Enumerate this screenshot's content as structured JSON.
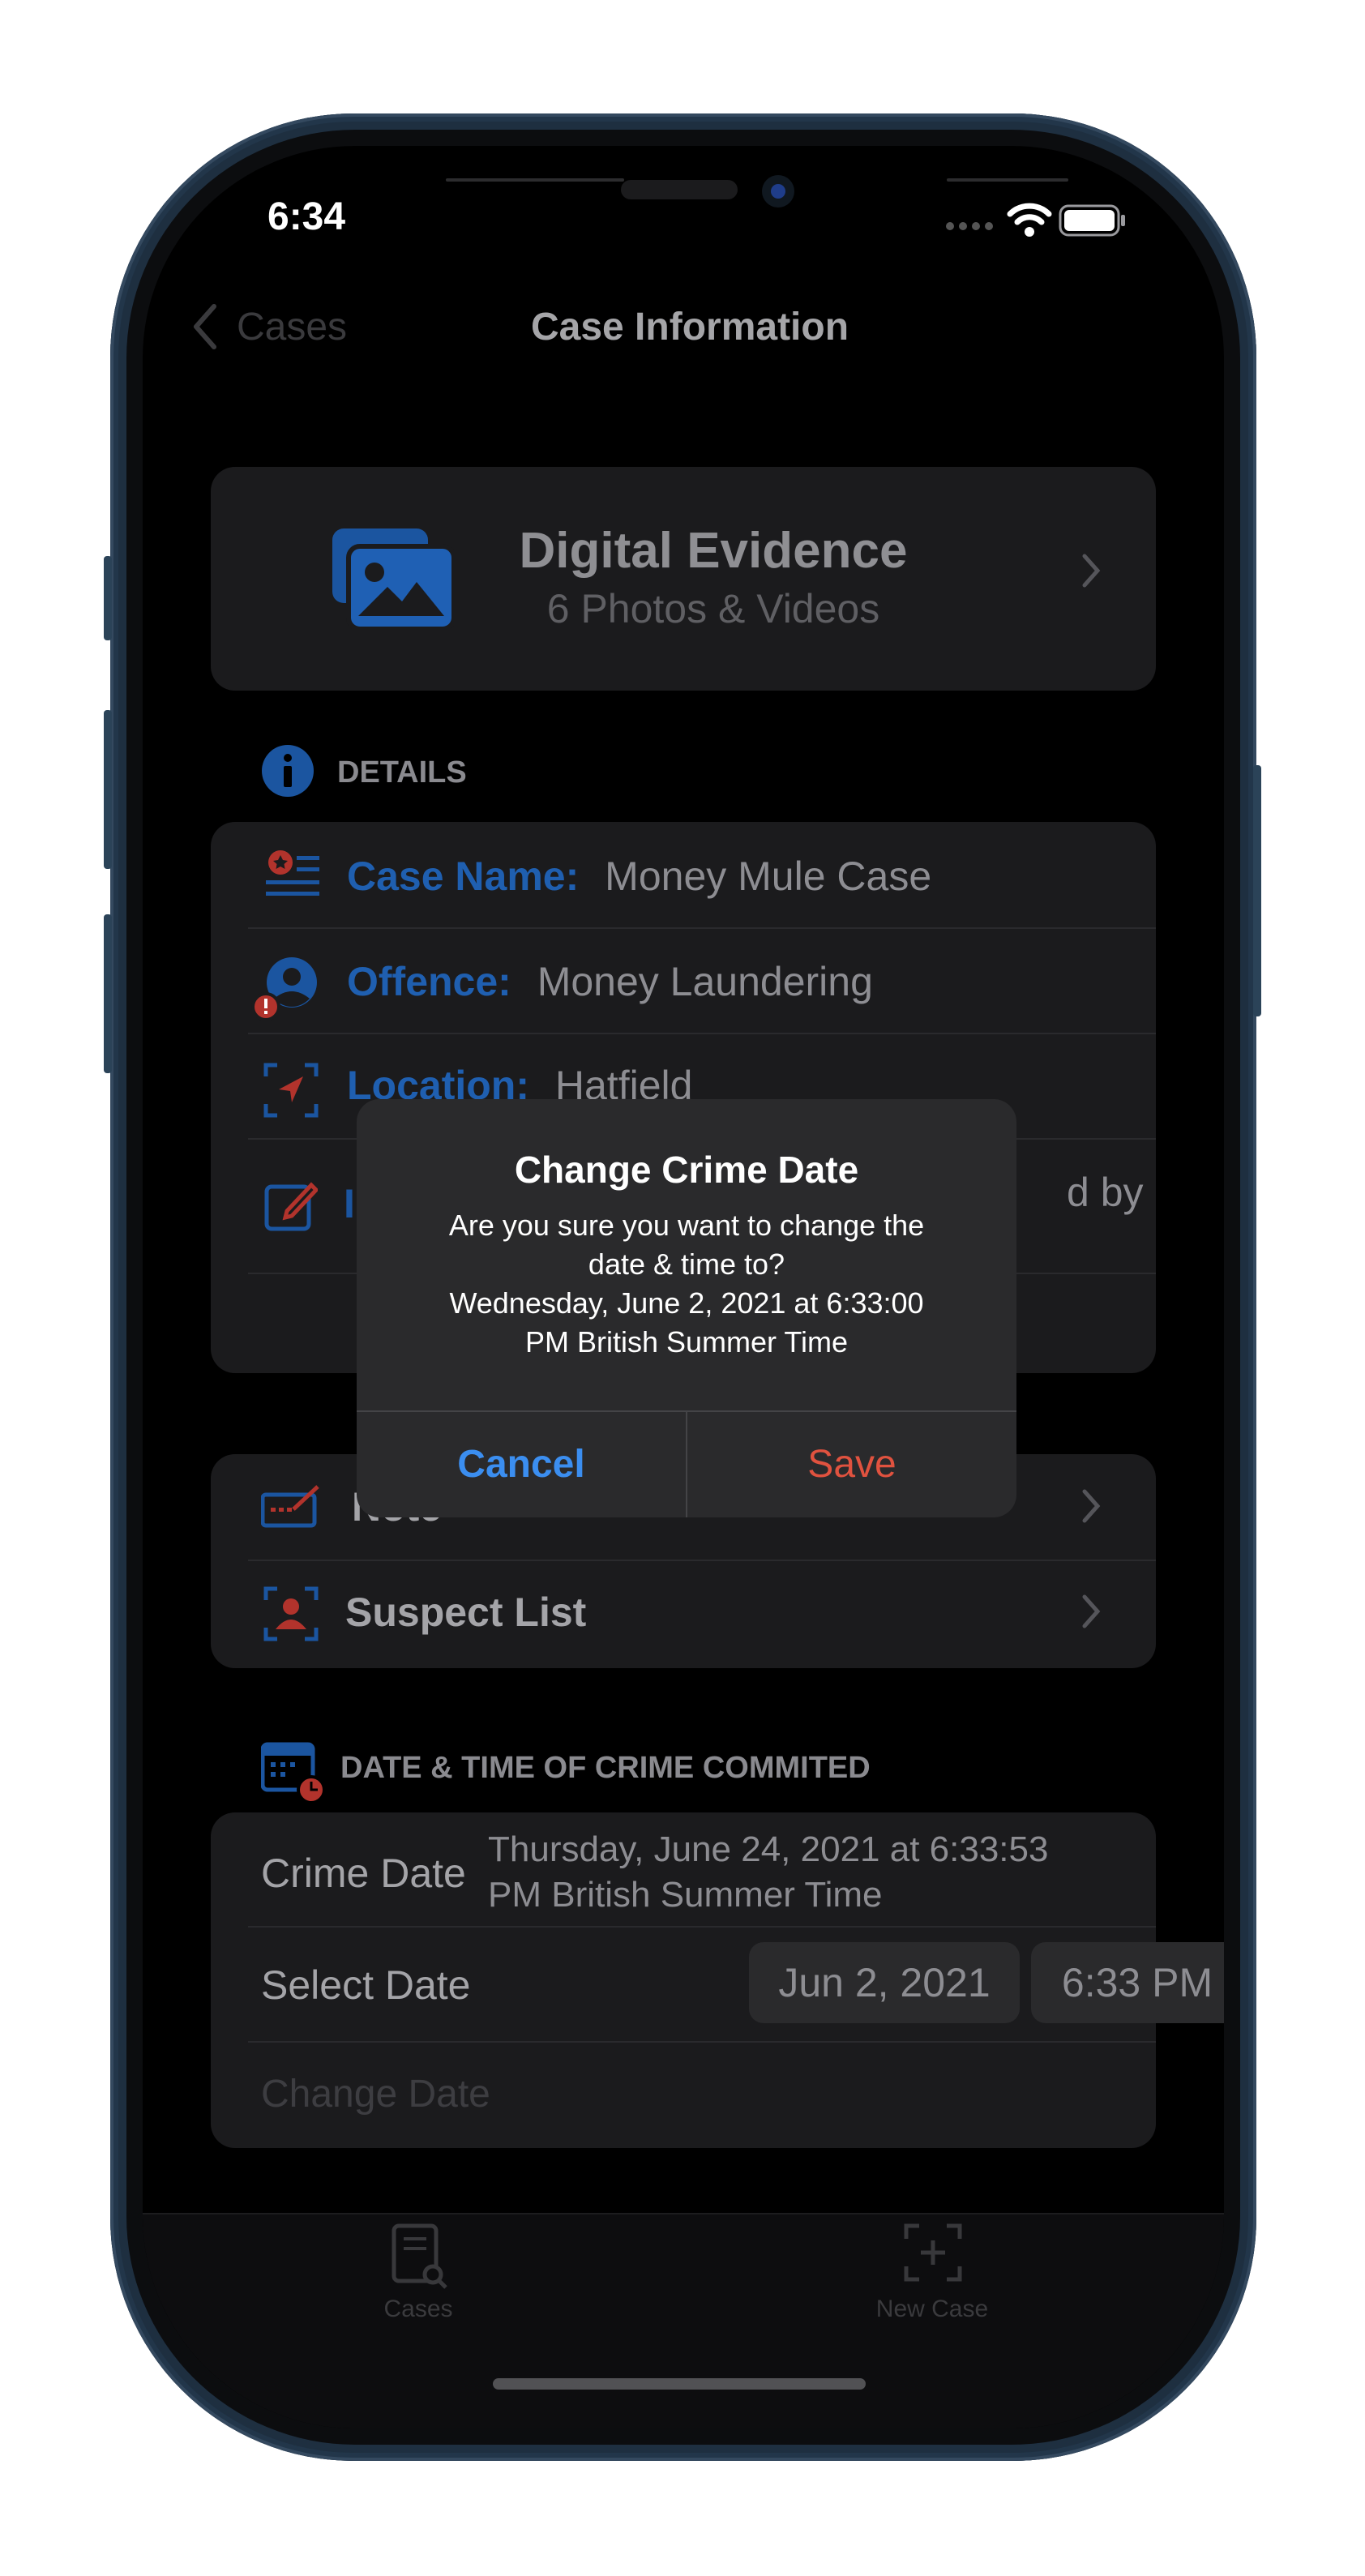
{
  "status": {
    "time": "6:34"
  },
  "nav": {
    "back_label": "Cases",
    "title": "Case Information"
  },
  "evidence": {
    "title": "Digital Evidence",
    "subtitle": "6 Photos & Videos"
  },
  "details": {
    "header": "DETAILS",
    "case_name_label": "Case Name:",
    "case_name_value": "Money Mule Case",
    "offence_label": "Offence:",
    "offence_value": "Money Laundering",
    "location_label": "Location:",
    "location_value": "Hatfield",
    "partial_text": "d by"
  },
  "links": {
    "note": "Note",
    "suspect_list": "Suspect List"
  },
  "crime_date": {
    "header": "DATE & TIME OF CRIME COMMITED",
    "crime_date_label": "Crime Date",
    "crime_date_value_line1": "Thursday, June 24, 2021 at 6:33:53",
    "crime_date_value_line2": "PM British Summer Time",
    "select_date_label": "Select Date",
    "date_pill": "Jun 2, 2021",
    "time_pill": "6:33 PM",
    "change_date_label": "Change Date"
  },
  "alert": {
    "title": "Change Crime Date",
    "message_line1": "Are you sure you want to change the",
    "message_line2": "date & time to?",
    "message_line3": "Wednesday, June 2, 2021 at 6:33:00",
    "message_line4": "PM British Summer Time",
    "cancel": "Cancel",
    "save": "Save"
  },
  "tabbar": {
    "cases": "Cases",
    "new_case": "New Case"
  },
  "colors": {
    "accent_blue": "#1f5fb0",
    "alert_cancel_blue": "#3b8ef0",
    "alert_save_red": "#e0523f",
    "icon_red": "#b2332c"
  },
  "icons": [
    "back-chevron-icon",
    "photos-icon",
    "info-icon",
    "case-name-icon",
    "offence-icon",
    "location-icon",
    "edit-icon",
    "note-icon",
    "suspect-icon",
    "calendar-icon",
    "cases-tab-icon",
    "new-case-tab-icon",
    "wifi-icon",
    "battery-icon",
    "signal-icon"
  ]
}
